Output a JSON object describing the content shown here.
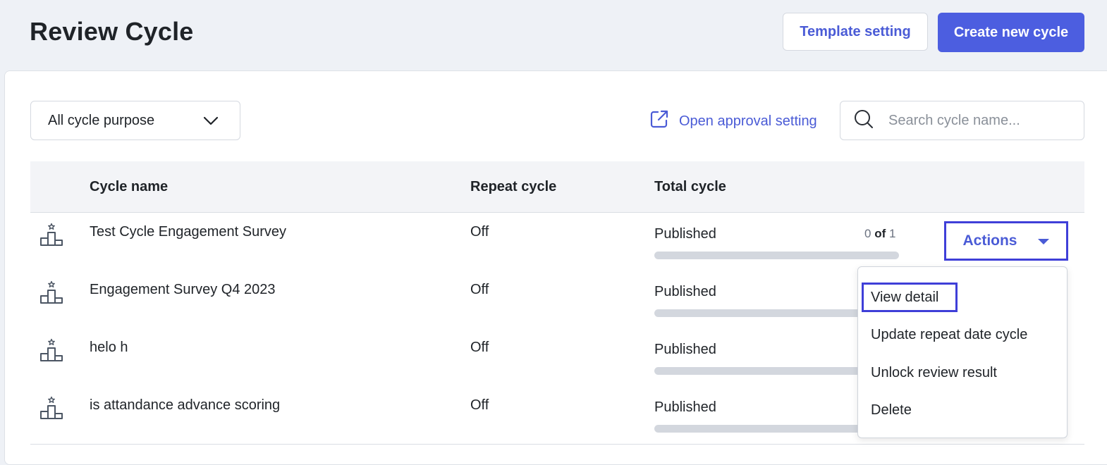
{
  "header": {
    "title": "Review Cycle",
    "template_setting_label": "Template setting",
    "create_cycle_label": "Create new cycle"
  },
  "filters": {
    "purpose_selected": "All cycle purpose",
    "open_approval_label": "Open approval setting",
    "search_placeholder": "Search cycle name..."
  },
  "table": {
    "columns": [
      "Cycle name",
      "Repeat cycle",
      "Total cycle"
    ],
    "rows": [
      {
        "name": "Test Cycle Engagement Survey",
        "repeat": "Off",
        "status": "Published",
        "done": "0",
        "of_label": "of",
        "total": "1",
        "progress": 0
      },
      {
        "name": "Engagement Survey Q4 2023",
        "repeat": "Off",
        "status": "Published",
        "progress": 0
      },
      {
        "name": "helo h",
        "repeat": "Off",
        "status": "Published",
        "progress": 0
      },
      {
        "name": "is attandance advance scoring",
        "repeat": "Off",
        "status": "Published",
        "progress": 0
      }
    ]
  },
  "actions": {
    "button_label": "Actions",
    "menu": [
      "View detail",
      "Update repeat date cycle",
      "Unlock review result",
      "Delete"
    ]
  },
  "colors": {
    "accent": "#4c5ee0",
    "highlight_border": "#3f3fd8",
    "progress_track": "#d3d7de",
    "background": "#eef1f6"
  },
  "icons": {
    "row_icon": "podium-star-icon",
    "filter_chevron": "chevron-down-icon",
    "approval": "external-link-icon",
    "search": "search-icon",
    "actions_caret": "caret-down-icon"
  }
}
